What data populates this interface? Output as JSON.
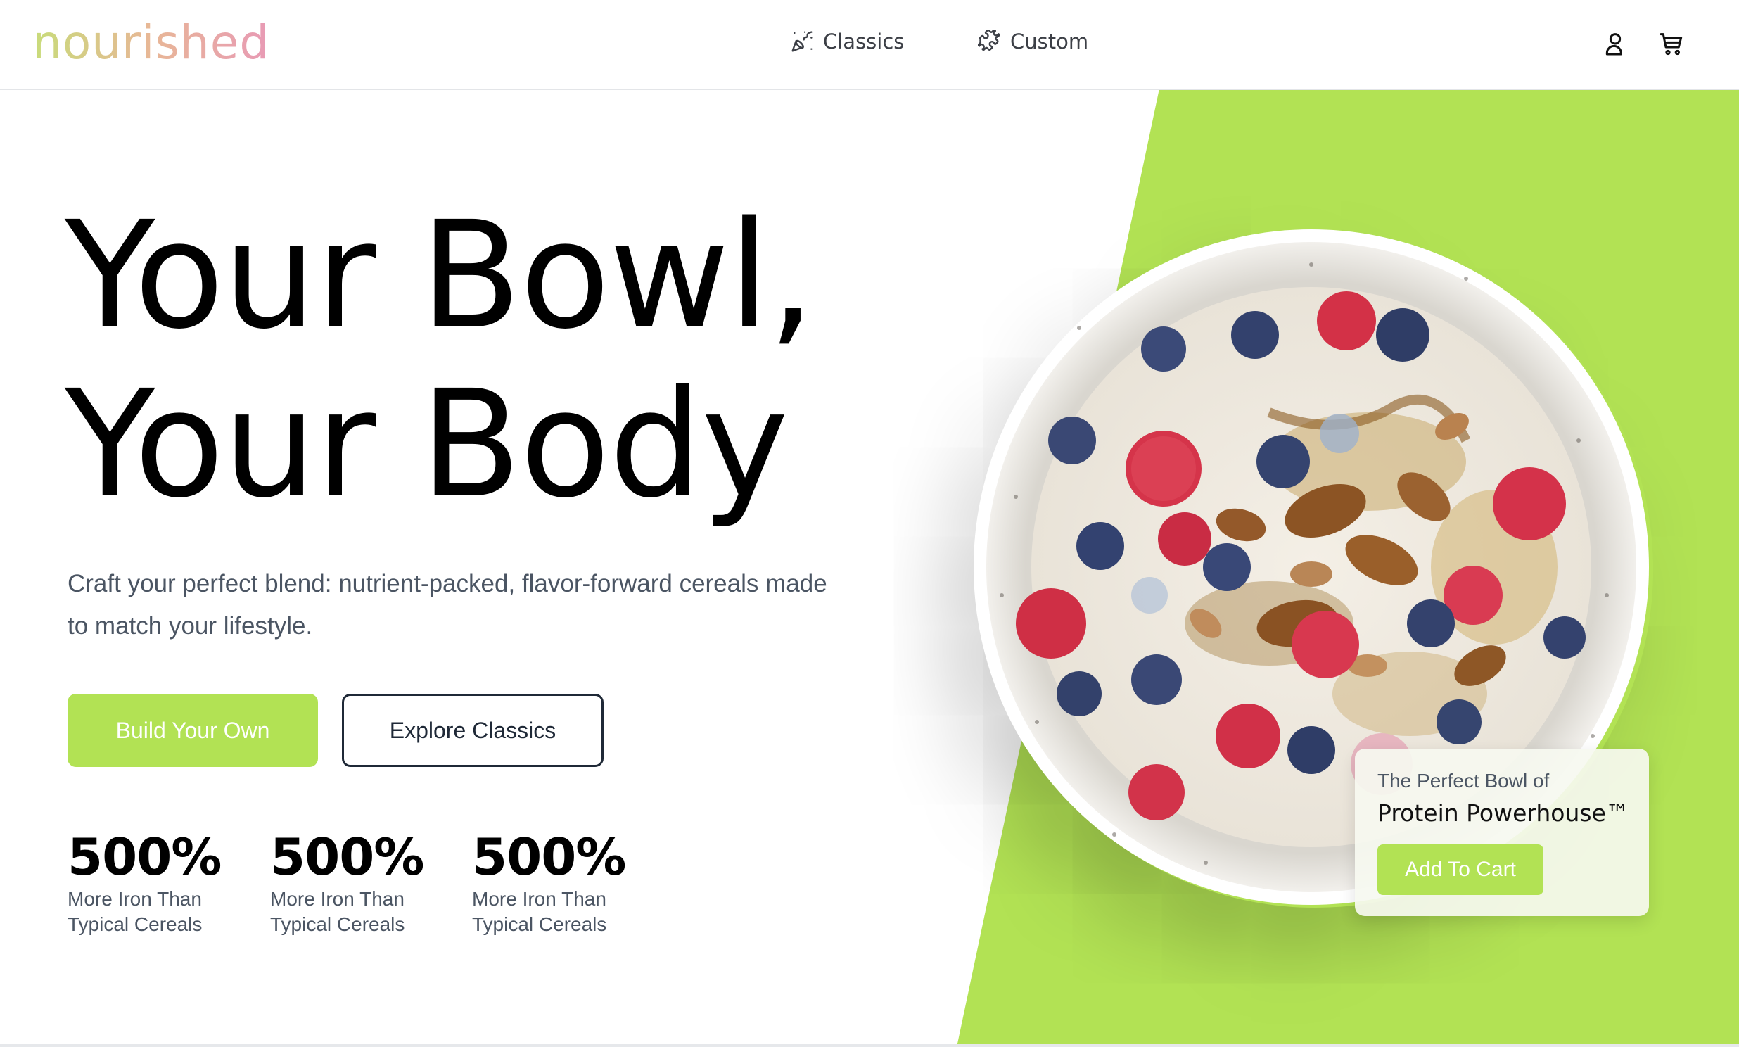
{
  "header": {
    "logo": "nourished",
    "nav": [
      {
        "label": "Classics",
        "icon": "party-popper-icon"
      },
      {
        "label": "Custom",
        "icon": "puzzle-icon"
      }
    ],
    "actions": [
      {
        "icon": "user-icon"
      },
      {
        "icon": "cart-icon"
      }
    ]
  },
  "hero": {
    "headline_line1": "Your Bowl,",
    "headline_line2": "Your Body",
    "subtitle": "Craft your perfect blend: nutrient-packed, flavor-forward cereals made to match your lifestyle.",
    "primary_button": "Build Your Own",
    "secondary_button": "Explore Classics",
    "stats": [
      {
        "value": "500%",
        "label": "More Iron Than Typical Cereals"
      },
      {
        "value": "500%",
        "label": "More Iron Than Typical Cereals"
      },
      {
        "value": "500%",
        "label": "More Iron Than Typical Cereals"
      }
    ]
  },
  "product_card": {
    "pretitle": "The Perfect Bowl of",
    "title": "Protein Powerhouse™",
    "button": "Add To Cart"
  },
  "colors": {
    "accent": "#b2e254",
    "text_dark": "#000000",
    "text_muted": "#4b5563"
  }
}
